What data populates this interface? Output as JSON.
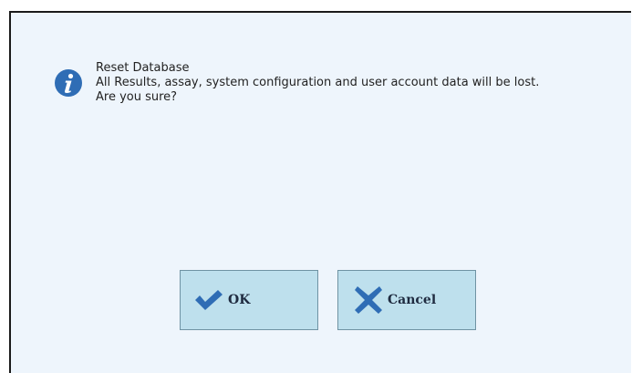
{
  "dialog": {
    "message_title": "Reset Database",
    "message_line1": "All Results, assay, system configuration and user account data will be lost.",
    "message_line2": "Are you sure?",
    "icon": "info-icon"
  },
  "buttons": {
    "ok_label": "OK",
    "ok_icon": "checkmark-icon",
    "cancel_label": "Cancel",
    "cancel_icon": "cross-icon"
  },
  "colors": {
    "dialog_background": "#eef5fc",
    "button_background": "#bee0ed",
    "icon_blue": "#2f6db5"
  }
}
